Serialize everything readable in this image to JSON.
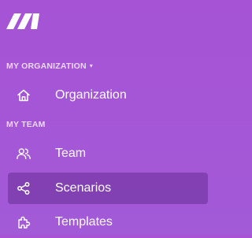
{
  "brand": {
    "logo_name": "make-logo",
    "accent_color": "#a653d6"
  },
  "sections": {
    "organization": {
      "label": "MY ORGANIZATION",
      "caret": "▾"
    },
    "team": {
      "label": "MY TEAM"
    }
  },
  "nav": {
    "organization": {
      "label": "Organization",
      "icon": "home-icon"
    },
    "team": {
      "label": "Team",
      "icon": "users-icon"
    },
    "scenarios": {
      "label": "Scenarios",
      "icon": "share-icon",
      "active": true
    },
    "templates": {
      "label": "Templates",
      "icon": "puzzle-icon"
    }
  }
}
